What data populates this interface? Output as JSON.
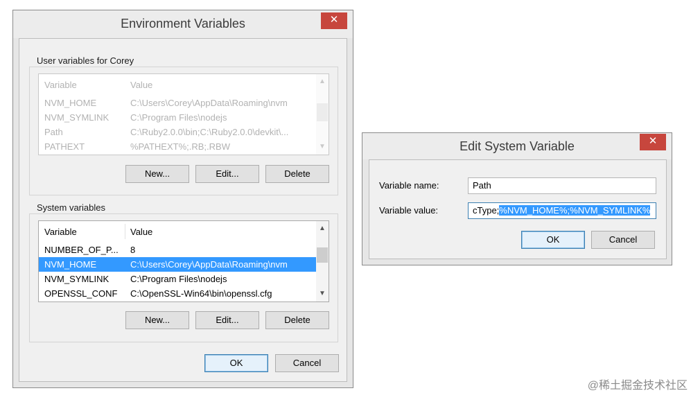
{
  "env_dialog": {
    "title": "Environment Variables",
    "close_glyph": "✕",
    "user_group": {
      "label": "User variables for Corey",
      "columns": [
        "Variable",
        "Value"
      ],
      "rows": [
        {
          "variable": "NVM_HOME",
          "value": "C:\\Users\\Corey\\AppData\\Roaming\\nvm"
        },
        {
          "variable": "NVM_SYMLINK",
          "value": "C:\\Program Files\\nodejs"
        },
        {
          "variable": "Path",
          "value": "C:\\Ruby2.0.0\\bin;C:\\Ruby2.0.0\\devkit\\..."
        },
        {
          "variable": "PATHEXT",
          "value": "%PATHEXT%;.RB;.RBW"
        }
      ],
      "buttons": {
        "new": "New...",
        "edit": "Edit...",
        "delete": "Delete"
      }
    },
    "system_group": {
      "label": "System variables",
      "columns": [
        "Variable",
        "Value"
      ],
      "rows": [
        {
          "variable": "NUMBER_OF_P...",
          "value": "8"
        },
        {
          "variable": "NVM_HOME",
          "value": "C:\\Users\\Corey\\AppData\\Roaming\\nvm",
          "selected": true
        },
        {
          "variable": "NVM_SYMLINK",
          "value": "C:\\Program Files\\nodejs"
        },
        {
          "variable": "OPENSSL_CONF",
          "value": "C:\\OpenSSL-Win64\\bin\\openssl.cfg"
        }
      ],
      "buttons": {
        "new": "New...",
        "edit": "Edit...",
        "delete": "Delete"
      }
    },
    "ok_label": "OK",
    "cancel_label": "Cancel"
  },
  "edit_dialog": {
    "title": "Edit System Variable",
    "close_glyph": "✕",
    "name_label": "Variable name:",
    "name_value": "Path",
    "value_label": "Variable value:",
    "value_unselected": "cType;",
    "value_selected": "%NVM_HOME%;%NVM_SYMLINK%",
    "ok_label": "OK",
    "cancel_label": "Cancel"
  },
  "watermark": "@稀土掘金技术社区",
  "scroll_arrows": {
    "up": "▲",
    "down": "▼"
  },
  "colors": {
    "selection": "#3399ff",
    "close_button": "#c7463d",
    "default_button_border": "#3c7fb1"
  }
}
